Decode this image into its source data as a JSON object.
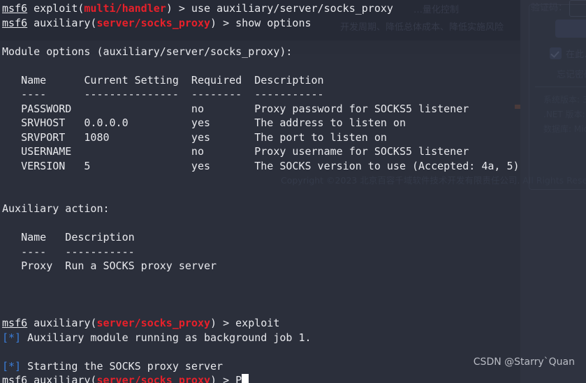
{
  "window": {
    "type": "terminal",
    "app": "msfconsole",
    "background_color": "#2b2f3b",
    "foreground_color": "#e8e9ed",
    "accent_red": "#e8202a",
    "accent_blue": "#3b7dd8"
  },
  "terminal": {
    "lines": [
      {
        "id": "line-1",
        "kind": "prompt",
        "segments": [
          {
            "text": "msf6",
            "style": "prompt"
          },
          {
            "text": " exploit(",
            "style": "white"
          },
          {
            "text": "multi/handler",
            "style": "red"
          },
          {
            "text": ") > use auxiliary/server/socks_proxy",
            "style": "white"
          }
        ],
        "plain": "msf6 exploit(multi/handler) > use auxiliary/server/socks_proxy"
      },
      {
        "id": "line-2",
        "kind": "prompt",
        "segments": [
          {
            "text": "msf6",
            "style": "prompt"
          },
          {
            "text": " auxiliary(",
            "style": "white"
          },
          {
            "text": "server/socks_proxy",
            "style": "red"
          },
          {
            "text": ") > show options",
            "style": "white"
          }
        ],
        "plain": "msf6 auxiliary(server/socks_proxy) > show options"
      },
      {
        "id": "line-3",
        "kind": "blank",
        "plain": ""
      },
      {
        "id": "line-4",
        "kind": "output",
        "plain": "Module options (auxiliary/server/socks_proxy):"
      },
      {
        "id": "line-5",
        "kind": "blank",
        "plain": ""
      },
      {
        "id": "line-6",
        "kind": "output",
        "plain": "   Name      Current Setting  Required  Description"
      },
      {
        "id": "line-7",
        "kind": "output",
        "plain": "   ----      ---------------  --------  -----------"
      },
      {
        "id": "line-8",
        "kind": "output",
        "plain": "   PASSWORD                   no        Proxy password for SOCKS5 listener"
      },
      {
        "id": "line-9",
        "kind": "output",
        "plain": "   SRVHOST   0.0.0.0          yes       The address to listen on"
      },
      {
        "id": "line-10",
        "kind": "output",
        "plain": "   SRVPORT   1080             yes       The port to listen on"
      },
      {
        "id": "line-11",
        "kind": "output",
        "plain": "   USERNAME                   no        Proxy username for SOCKS5 listener"
      },
      {
        "id": "line-12",
        "kind": "output",
        "plain": "   VERSION   5                yes       The SOCKS version to use (Accepted: 4a, 5)"
      },
      {
        "id": "line-13",
        "kind": "blank",
        "plain": ""
      },
      {
        "id": "line-14",
        "kind": "blank",
        "plain": ""
      },
      {
        "id": "line-15",
        "kind": "output",
        "plain": "Auxiliary action:"
      },
      {
        "id": "line-16",
        "kind": "blank",
        "plain": ""
      },
      {
        "id": "line-17",
        "kind": "output",
        "plain": "   Name   Description"
      },
      {
        "id": "line-18",
        "kind": "output",
        "plain": "   ----   -----------"
      },
      {
        "id": "line-19",
        "kind": "output",
        "plain": "   Proxy  Run a SOCKS proxy server"
      },
      {
        "id": "line-20",
        "kind": "blank",
        "plain": ""
      },
      {
        "id": "line-21",
        "kind": "blank",
        "plain": ""
      },
      {
        "id": "line-22",
        "kind": "blank",
        "plain": ""
      },
      {
        "id": "line-23",
        "kind": "prompt",
        "segments": [
          {
            "text": "msf6",
            "style": "prompt"
          },
          {
            "text": " auxiliary(",
            "style": "white"
          },
          {
            "text": "server/socks_proxy",
            "style": "red"
          },
          {
            "text": ") > exploit",
            "style": "white"
          }
        ],
        "plain": "msf6 auxiliary(server/socks_proxy) > exploit"
      },
      {
        "id": "line-24",
        "kind": "status",
        "segments": [
          {
            "text": "[*]",
            "style": "blue"
          },
          {
            "text": " Auxiliary module running as background job 1.",
            "style": "white"
          }
        ],
        "plain": "[*] Auxiliary module running as background job 1."
      },
      {
        "id": "line-25",
        "kind": "blank",
        "plain": ""
      },
      {
        "id": "line-26",
        "kind": "status",
        "segments": [
          {
            "text": "[*]",
            "style": "blue"
          },
          {
            "text": " Starting the SOCKS proxy server",
            "style": "white"
          }
        ],
        "plain": "[*] Starting the SOCKS proxy server"
      },
      {
        "id": "line-27",
        "kind": "prompt-active",
        "segments": [
          {
            "text": "msf6",
            "style": "prompt"
          },
          {
            "text": " auxiliary(",
            "style": "white"
          },
          {
            "text": "server/socks_proxy",
            "style": "red"
          },
          {
            "text": ") > P",
            "style": "white"
          }
        ],
        "plain": "msf6 auxiliary(server/socks_proxy) > P",
        "cursor": true
      }
    ],
    "module_options": {
      "title": "Module options (auxiliary/server/socks_proxy):",
      "columns": [
        "Name",
        "Current Setting",
        "Required",
        "Description"
      ],
      "rows": [
        {
          "name": "PASSWORD",
          "current_setting": "",
          "required": "no",
          "description": "Proxy password for SOCKS5 listener"
        },
        {
          "name": "SRVHOST",
          "current_setting": "0.0.0.0",
          "required": "yes",
          "description": "The address to listen on"
        },
        {
          "name": "SRVPORT",
          "current_setting": "1080",
          "required": "yes",
          "description": "The port to listen on"
        },
        {
          "name": "USERNAME",
          "current_setting": "",
          "required": "no",
          "description": "Proxy username for SOCKS5 listener"
        },
        {
          "name": "VERSION",
          "current_setting": "5",
          "required": "yes",
          "description": "The SOCKS version to use (Accepted: 4a, 5)"
        }
      ]
    },
    "auxiliary_action": {
      "title": "Auxiliary action:",
      "columns": [
        "Name",
        "Description"
      ],
      "rows": [
        {
          "name": "Proxy",
          "description": "Run a SOCKS proxy server"
        }
      ]
    }
  },
  "background_page": {
    "hero_tag_1": "…量化控制",
    "hero_tag_2": "开发周期、降低总体成本、降低实施风险",
    "captcha_label": "验证码：",
    "keep_logged_in": "在此…",
    "forgot_password": "忘记密码",
    "version_line_1": "系统版本: 3…",
    "version_line_2": ".NET 版本:",
    "version_line_3": "数据库: Mic…",
    "copyright": "Copyright ©2023 北京百容千域软件技术开发有限责任公司. All Rights Reserved"
  },
  "watermark": {
    "text": "CSDN @Starry`Quan"
  }
}
